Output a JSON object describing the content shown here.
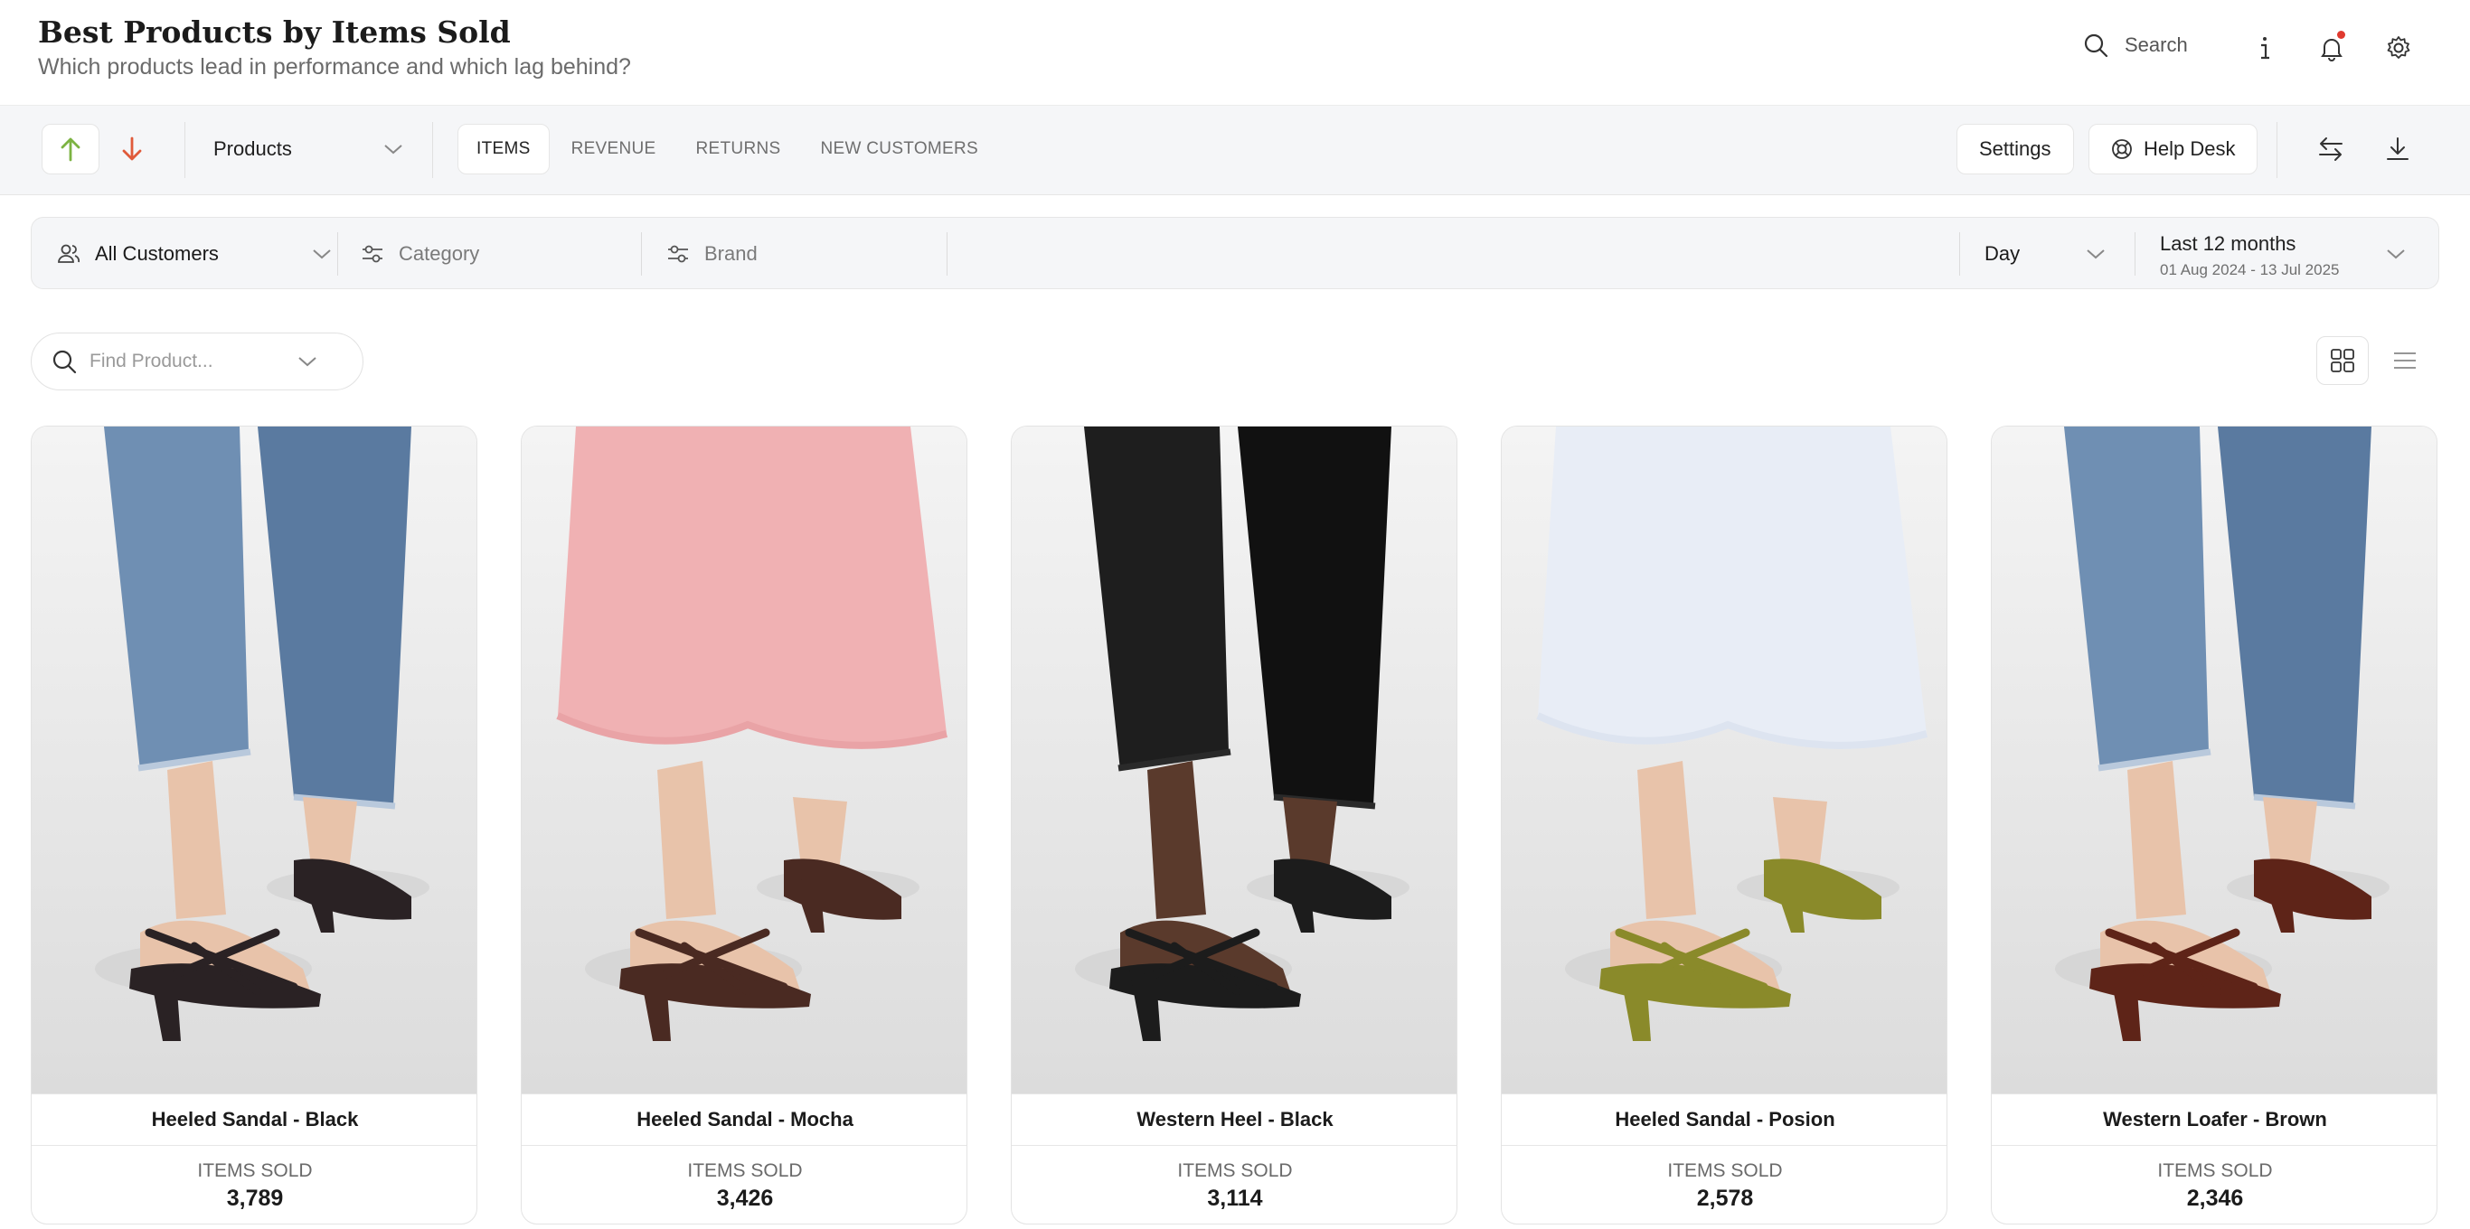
{
  "header": {
    "title": "Best Products by Items Sold",
    "subtitle": "Which products lead in performance and which lag behind?",
    "search_label": "Search"
  },
  "toolbar": {
    "products_select": "Products",
    "tabs": [
      {
        "label": "ITEMS",
        "active": true
      },
      {
        "label": "REVENUE",
        "active": false
      },
      {
        "label": "RETURNS",
        "active": false
      },
      {
        "label": "NEW CUSTOMERS",
        "active": false
      }
    ],
    "settings_label": "Settings",
    "helpdesk_label": "Help Desk"
  },
  "filters": {
    "customers": "All Customers",
    "category_placeholder": "Category",
    "brand_placeholder": "Brand",
    "granularity": "Day",
    "range_label": "Last 12 months",
    "range_dates": "01 Aug 2024 - 13 Jul 2025"
  },
  "find": {
    "placeholder": "Find Product..."
  },
  "products": [
    {
      "name": "Heeled Sandal - Black",
      "metric_label": "ITEMS SOLD",
      "value": "3,789",
      "pants": "denim",
      "shoe": "#2a2224"
    },
    {
      "name": "Heeled Sandal - Mocha",
      "metric_label": "ITEMS SOLD",
      "value": "3,426",
      "pants": "pink-skirt",
      "shoe": "#4a2a22"
    },
    {
      "name": "Western Heel - Black",
      "metric_label": "ITEMS SOLD",
      "value": "3,114",
      "pants": "black-trousers",
      "shoe": "#1c1c1c"
    },
    {
      "name": "Heeled Sandal - Posion",
      "metric_label": "ITEMS SOLD",
      "value": "2,578",
      "pants": "white-skirt",
      "shoe": "#8a8a2a"
    },
    {
      "name": "Western Loafer - Brown",
      "metric_label": "ITEMS SOLD",
      "value": "2,346",
      "pants": "denim",
      "shoe": "#5e2418"
    }
  ],
  "colors": {
    "accent_up": "#7cb342",
    "accent_down": "#e05a3a",
    "notification": "#e03a2f"
  },
  "icons": [
    "search-icon",
    "info-icon",
    "bell-icon",
    "gear-icon",
    "arrow-up-icon",
    "arrow-down-icon",
    "chevron-down-icon",
    "lifebuoy-icon",
    "swap-icon",
    "download-icon",
    "customers-icon",
    "sliders-icon",
    "grid-view-icon",
    "list-view-icon"
  ]
}
